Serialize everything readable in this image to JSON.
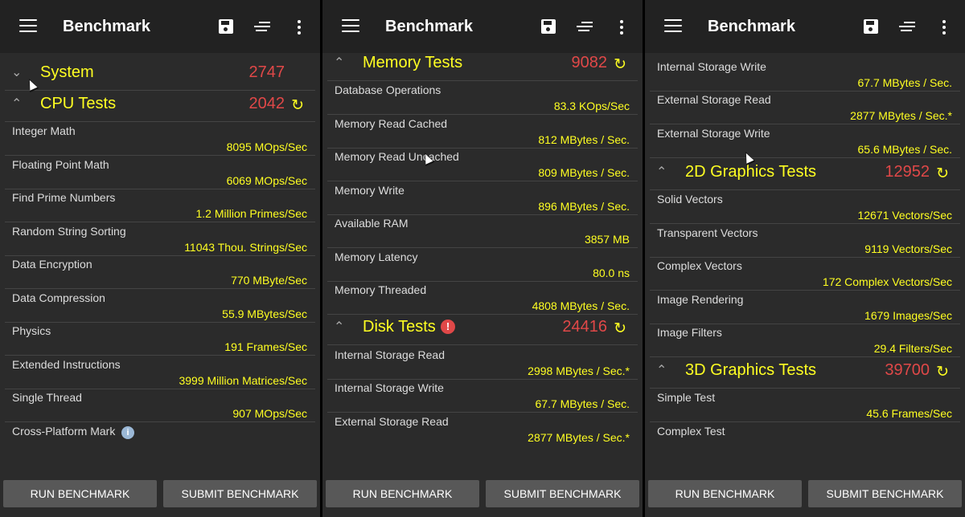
{
  "icons": {
    "menu": "menu-icon",
    "save": "save-icon",
    "sort": "sort-icon",
    "more": "more-vert-icon",
    "reload": "reload-icon",
    "chevron": "chevron-icon",
    "warning": "warning-icon",
    "info": "info-icon"
  },
  "colors": {
    "accent_yellow": "#ffff22",
    "score_red": "#e04848",
    "background": "#2b2b2b",
    "appbar": "#222222",
    "button": "#585858"
  },
  "panels": [
    {
      "title": "Benchmark",
      "buttons": {
        "run": "RUN BENCHMARK",
        "submit": "SUBMIT BENCHMARK"
      },
      "sections": [
        {
          "title": "System",
          "score": "2747",
          "chevron": "⌄",
          "reload": "",
          "warning": "",
          "items": []
        },
        {
          "title": "CPU Tests",
          "score": "2042",
          "chevron": "⌃",
          "reload": "↻",
          "warning": "",
          "items": [
            {
              "label": "Integer Math",
              "value": "8095 MOps/Sec"
            },
            {
              "label": "Floating Point Math",
              "value": "6069 MOps/Sec"
            },
            {
              "label": "Find Prime Numbers",
              "value": "1.2 Million Primes/Sec"
            },
            {
              "label": "Random String Sorting",
              "value": "11043 Thou. Strings/Sec"
            },
            {
              "label": "Data Encryption",
              "value": "770 MByte/Sec"
            },
            {
              "label": "Data Compression",
              "value": "55.9 MBytes/Sec"
            },
            {
              "label": "Physics",
              "value": "191 Frames/Sec"
            },
            {
              "label": "Extended Instructions",
              "value": "3999 Million Matrices/Sec"
            },
            {
              "label": "Single Thread",
              "value": "907 MOps/Sec"
            },
            {
              "label": "Cross-Platform Mark",
              "value": "",
              "info": "i"
            }
          ]
        }
      ]
    },
    {
      "title": "Benchmark",
      "buttons": {
        "run": "RUN BENCHMARK",
        "submit": "SUBMIT BENCHMARK"
      },
      "sections": [
        {
          "title": "Memory Tests",
          "score": "9082",
          "chevron": "⌃",
          "reload": "↻",
          "warning": "",
          "items": [
            {
              "label": "Database Operations",
              "value": "83.3 KOps/Sec"
            },
            {
              "label": "Memory Read Cached",
              "value": "812 MBytes / Sec."
            },
            {
              "label": "Memory Read Uncached",
              "value": "809 MBytes / Sec."
            },
            {
              "label": "Memory Write",
              "value": "896 MBytes / Sec."
            },
            {
              "label": "Available RAM",
              "value": "3857 MB"
            },
            {
              "label": "Memory Latency",
              "value": "80.0 ns"
            },
            {
              "label": "Memory Threaded",
              "value": "4808 MBytes / Sec."
            }
          ]
        },
        {
          "title": "Disk Tests",
          "score": "24416",
          "chevron": "⌃",
          "reload": "↻",
          "warning": "!",
          "items": [
            {
              "label": "Internal Storage Read",
              "value": "2998 MBytes / Sec.*"
            },
            {
              "label": "Internal Storage Write",
              "value": "67.7 MBytes / Sec."
            },
            {
              "label": "External Storage Read",
              "value": "2877 MBytes / Sec.*"
            }
          ]
        }
      ]
    },
    {
      "title": "Benchmark",
      "buttons": {
        "run": "RUN BENCHMARK",
        "submit": "SUBMIT BENCHMARK"
      },
      "sections": [
        {
          "title": "",
          "score": "",
          "chevron": "",
          "reload": "",
          "warning": "",
          "items": [
            {
              "label": "Internal Storage Write",
              "value": "67.7 MBytes / Sec."
            },
            {
              "label": "External Storage Read",
              "value": "2877 MBytes / Sec.*"
            },
            {
              "label": "External Storage Write",
              "value": "65.6 MBytes / Sec."
            }
          ]
        },
        {
          "title": "2D Graphics Tests",
          "score": "12952",
          "chevron": "⌃",
          "reload": "↻",
          "warning": "",
          "items": [
            {
              "label": "Solid Vectors",
              "value": "12671 Vectors/Sec"
            },
            {
              "label": "Transparent Vectors",
              "value": "9119 Vectors/Sec"
            },
            {
              "label": "Complex Vectors",
              "value": "172 Complex Vectors/Sec"
            },
            {
              "label": "Image Rendering",
              "value": "1679 Images/Sec"
            },
            {
              "label": "Image Filters",
              "value": "29.4 Filters/Sec"
            }
          ]
        },
        {
          "title": "3D Graphics Tests",
          "score": "39700",
          "chevron": "⌃",
          "reload": "↻",
          "warning": "",
          "items": [
            {
              "label": "Simple Test",
              "value": "45.6 Frames/Sec"
            },
            {
              "label": "Complex Test",
              "value": ""
            }
          ]
        }
      ]
    }
  ]
}
